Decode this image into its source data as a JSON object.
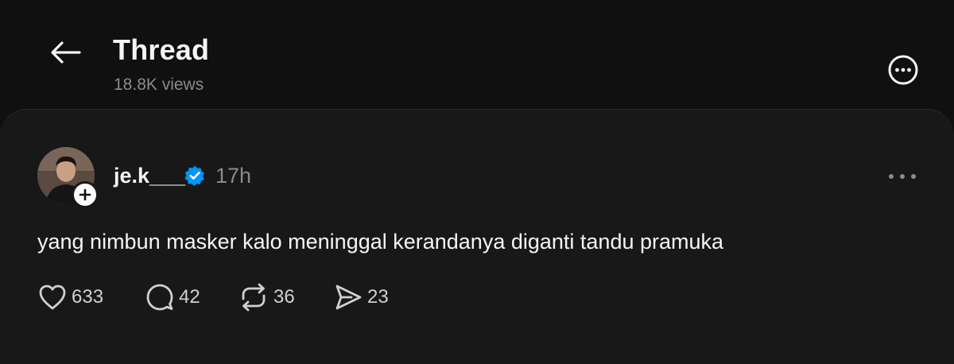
{
  "header": {
    "title": "Thread",
    "views": "18.8K views"
  },
  "post": {
    "username": "je.k___",
    "time": "17h",
    "text": "yang nimbun masker kalo meninggal kerandanya diganti tandu pramuka",
    "actions": {
      "likes": "633",
      "replies": "42",
      "reposts": "36",
      "shares": "23"
    }
  },
  "colors": {
    "background": "#101010",
    "card": "#181818",
    "verified": "#0095f6",
    "muted_text": "#8a8a8a"
  },
  "icons": [
    "back-arrow-icon",
    "more-circle-icon",
    "verified-badge-icon",
    "follow-plus-icon",
    "more-horizontal-icon",
    "heart-icon",
    "comment-icon",
    "repost-icon",
    "share-icon"
  ]
}
